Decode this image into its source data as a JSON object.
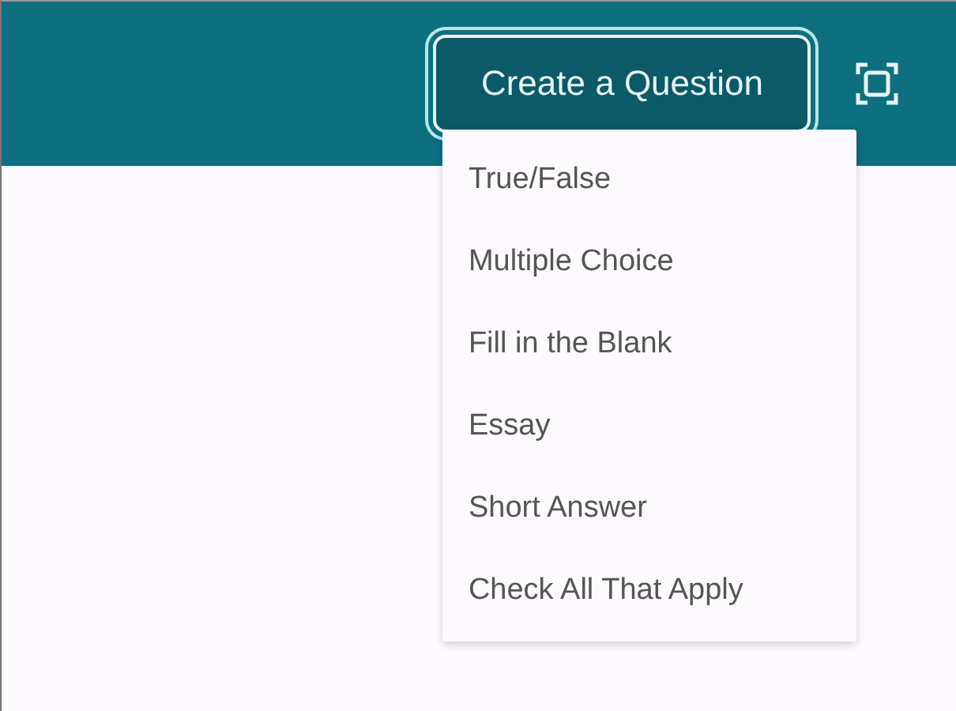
{
  "header": {
    "button": {
      "label": "Create a Question",
      "expanded": true
    }
  },
  "menu": {
    "items": [
      {
        "label": "True/False"
      },
      {
        "label": "Multiple Choice"
      },
      {
        "label": "Fill in the Blank"
      },
      {
        "label": "Essay"
      },
      {
        "label": "Short Answer"
      },
      {
        "label": "Check All That Apply"
      }
    ]
  }
}
